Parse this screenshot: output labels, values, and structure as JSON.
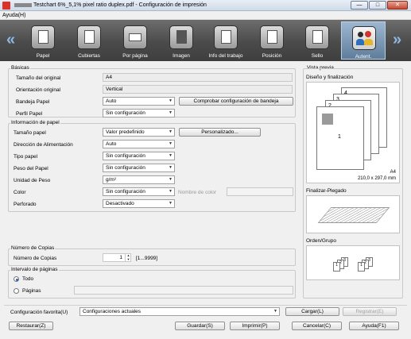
{
  "window": {
    "title": "Testchart 6%_5,1% pixel ratio duplex.pdf - Configuración de impresión",
    "minimize": "—",
    "maximize": "□",
    "close": "✕"
  },
  "menu": {
    "help": "Ayuda(H)"
  },
  "ribbon": {
    "tabs": [
      {
        "label": "Papel",
        "icon": "paper-icon"
      },
      {
        "label": "Cubiertas",
        "icon": "cover-icon"
      },
      {
        "label": "Por página",
        "icon": "per-page-icon"
      },
      {
        "label": "Imagen",
        "icon": "image-icon"
      },
      {
        "label": "Info del trabajo",
        "icon": "job-info-icon"
      },
      {
        "label": "Posición",
        "icon": "position-icon"
      },
      {
        "label": "Sello",
        "icon": "stamp-icon"
      },
      {
        "label": "Autent.",
        "icon": "authentication-icon"
      }
    ],
    "active_tab": "Autent.",
    "prev": "«",
    "next": "»"
  },
  "basicas": {
    "title": "Básicas",
    "size_label": "Tamaño del original",
    "size_value": "A4",
    "orient_label": "Orientación original",
    "orient_value": "Vertical",
    "tray_label": "Bandeja Papel",
    "tray_value": "Auto",
    "check_tray_button": "Comprobar configuración de bandeja",
    "profile_label": "Perfil Papel",
    "profile_value": "Sin configuración"
  },
  "info_papel": {
    "title": "Información de papel",
    "size_label": "Tamaño papel",
    "size_value": "Valor predefinido",
    "custom_button": "Personalizado...",
    "feed_label": "Dirección de Alimentación",
    "feed_value": "Auto",
    "type_label": "Tipo papel",
    "type_value": "Sin configuración",
    "weight_label": "Peso del Papel",
    "weight_value": "Sin configuración",
    "unit_label": "Unidad de Peso",
    "unit_value": "g/m²",
    "color_label": "Color",
    "color_value": "Sin configuración",
    "color_name_label": "Nombre de color",
    "punch_label": "Perforado",
    "punch_value": "Desactivado"
  },
  "copias": {
    "title": "Número de Copias",
    "label": "Número de Copias",
    "value": "1",
    "range": "[1...9999]"
  },
  "intervalo": {
    "title": "Intervalo de páginas",
    "all_label": "Todo",
    "pages_label": "Páginas",
    "selected": "all"
  },
  "preview": {
    "title": "Vista previa",
    "layout_title": "Diseño y finalización",
    "paper_name": "A4",
    "paper_dims": "210,0 x 297,0 mm",
    "fold_title": "Finalizar-Plegado",
    "order_title": "Orden/Grupo",
    "page_numbers": [
      "1",
      "2",
      "3",
      "4"
    ]
  },
  "bottom": {
    "favorite_label": "Configuración favorita(U)",
    "favorite_value": "Configuraciones actuales",
    "load_button": "Cargar(L)",
    "register_button": "Registrar(E)",
    "restore_button": "Restaurar(Z)",
    "save_button": "Guardar(S)",
    "print_button": "Imprimir(P)",
    "cancel_button": "Cancelar(C)",
    "help_button": "Ayuda(F1)"
  },
  "colors": {
    "ribbon_dark": "#4b4b4b",
    "active_tab": "#7f9ebd",
    "arrow": "#8fb9e6"
  }
}
